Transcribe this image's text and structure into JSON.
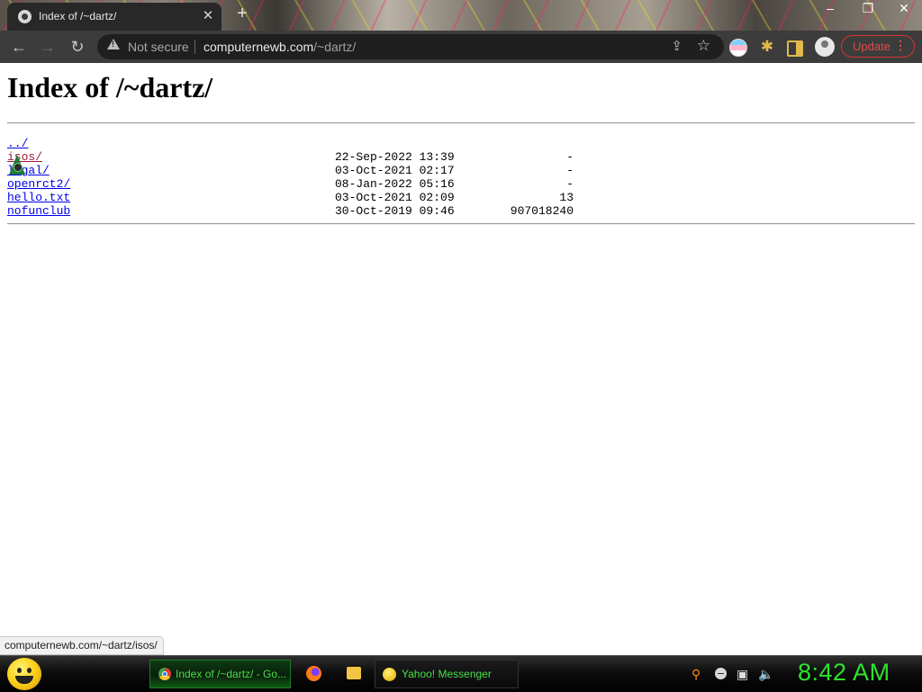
{
  "browser": {
    "tab_title": "Index of /~dartz/",
    "tab_close": "✕",
    "new_tab": "+",
    "window_controls": {
      "minimize": "–",
      "maximize": "❐",
      "close": "✕"
    },
    "nav": {
      "back": "←",
      "forward": "→",
      "reload": "↻"
    },
    "security_label": "Not secure",
    "url_host": "computernewb.com",
    "url_path": "/~dartz/",
    "share_icon": "share-icon",
    "star_icon": "☆",
    "update_label": "Update",
    "menu_icon": "⋮"
  },
  "page": {
    "heading": "Index of /~dartz/",
    "entries": [
      {
        "name": "../",
        "date": "",
        "size": "",
        "visited": false
      },
      {
        "name": "isos/",
        "date": "22-Sep-2022 13:39",
        "size": "-",
        "visited": true
      },
      {
        "name": "legal/",
        "date": "03-Oct-2021 02:17",
        "size": "-",
        "visited": false
      },
      {
        "name": "openrct2/",
        "date": "08-Jan-2022 05:16",
        "size": "-",
        "visited": false
      },
      {
        "name": "hello.txt",
        "date": "03-Oct-2021 02:09",
        "size": "13",
        "visited": false
      },
      {
        "name": "nofunclub",
        "date": "30-Oct-2019 09:46",
        "size": "907018240",
        "visited": false
      }
    ]
  },
  "status_bar": {
    "hover_url": "computernewb.com/~dartz/isos/"
  },
  "taskbar": {
    "chrome_label": "Index of /~dartz/ - Go...",
    "yahoo_label": "Yahoo! Messenger",
    "clock": "8:42 AM"
  },
  "colors": {
    "link": "#0000ee",
    "visited_link": "#a11c3a",
    "update_red": "#e34b45",
    "clock_green": "#2ee32e",
    "taskbar_text_green": "#48e048"
  }
}
